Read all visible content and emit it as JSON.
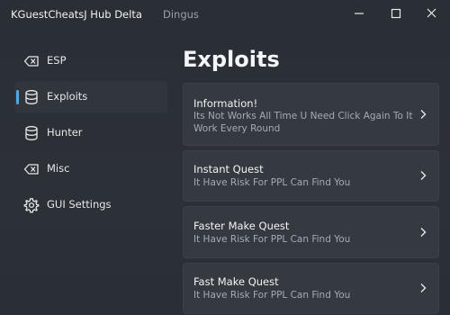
{
  "window": {
    "title": "KGuestCheatsJ Hub Delta",
    "subtitle": "Dingus"
  },
  "sidebar": {
    "items": [
      {
        "label": "ESP",
        "icon": "backspace-icon",
        "active": false
      },
      {
        "label": "Exploits",
        "icon": "database-icon",
        "active": true
      },
      {
        "label": "Hunter",
        "icon": "database-icon",
        "active": false
      },
      {
        "label": "Misc",
        "icon": "backspace-icon",
        "active": false
      },
      {
        "label": "GUI Settings",
        "icon": "gear-icon",
        "active": false
      }
    ]
  },
  "main": {
    "heading": "Exploits",
    "cards": [
      {
        "title": "Information!",
        "description": "Its Not Works All Time U Need Click Again To It Work Every Round"
      },
      {
        "title": "Instant Quest",
        "description": "It Have Risk For PPL Can Find You"
      },
      {
        "title": "Faster Make Quest",
        "description": "It Have Risk For PPL Can Find You"
      },
      {
        "title": "Fast Make Quest",
        "description": "It Have Risk For PPL Can Find You"
      }
    ]
  },
  "colors": {
    "accent": "#4fa7e6",
    "background": "#2b2f36",
    "card": "#353a41"
  }
}
